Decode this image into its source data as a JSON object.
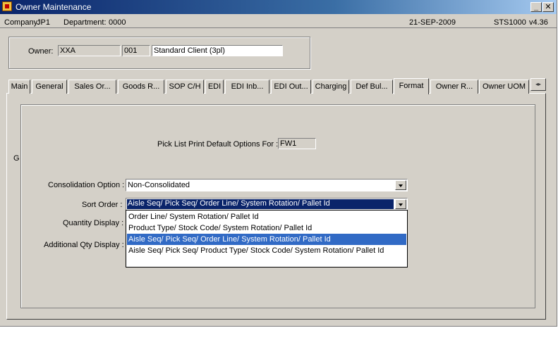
{
  "window": {
    "title": "Owner Maintenance",
    "minimize_label": "_",
    "close_label": "✕"
  },
  "status": {
    "company_label": "Company:",
    "company": "JP1",
    "department_label": "Department:",
    "department": "0000",
    "date": "21-SEP-2009",
    "program": "STS1000",
    "version": "v4.36"
  },
  "owner": {
    "label": "Owner:",
    "code": "XXA",
    "number": "001",
    "name": "Standard Client (3pl)"
  },
  "tabs": [
    {
      "label": "Main"
    },
    {
      "label": "General"
    },
    {
      "label": "Sales Or..."
    },
    {
      "label": "Goods R..."
    },
    {
      "label": "SOP C/H"
    },
    {
      "label": "EDI"
    },
    {
      "label": "EDI Inb..."
    },
    {
      "label": "EDI Out..."
    },
    {
      "label": "Charging"
    },
    {
      "label": "Def Bul..."
    },
    {
      "label": "Format"
    },
    {
      "label": "Owner R..."
    },
    {
      "label": "Owner UOM"
    }
  ],
  "tab_scroll_label": "◂▸",
  "format": {
    "side_letter": "G",
    "pick_list_label": "Pick List Print Default Options For :",
    "pick_list_value": "FW1",
    "consolidation_label": "Consolidation Option :",
    "consolidation_value": "Non-Consolidated",
    "sort_order_label": "Sort Order :",
    "sort_order_value": "Aisle Seq/ Pick Seq/ Order Line/ System Rotation/ Pallet Id",
    "quantity_display_label": "Quantity Display :",
    "additional_qty_label": "Additional Qty Display :",
    "sort_options": [
      "Order Line/ System Rotation/ Pallet Id",
      "Product Type/ Stock Code/ System Rotation/ Pallet Id",
      "Aisle Seq/ Pick Seq/ Order Line/ System Rotation/ Pallet Id",
      "Aisle Seq/ Pick Seq/ Product Type/ Stock Code/ System Rotation/ Pallet Id"
    ],
    "highlighted_option_index": 2
  }
}
